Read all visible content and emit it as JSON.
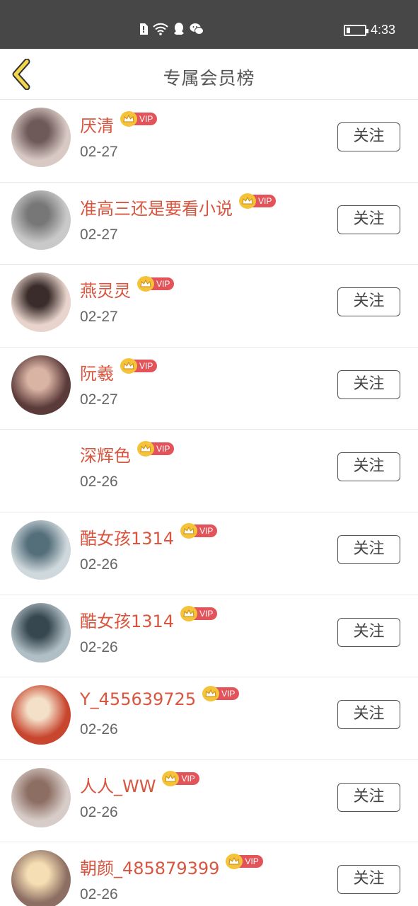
{
  "status_bar": {
    "time": "4:33",
    "battery_level": 0.2,
    "icons": [
      "sim-alert-icon",
      "wifi-icon",
      "qq-icon",
      "wechat-icon"
    ]
  },
  "header": {
    "back_icon": "chevron-left-icon",
    "title": "专属会员榜"
  },
  "colors": {
    "name": "#d9553f",
    "vip_badge": "#e2545a",
    "crown": "#f5c33a",
    "status_bar": "#474747",
    "back_icon_fill": "#f2d64b"
  },
  "members": [
    {
      "name": "厌清",
      "badge": "VIP",
      "date": "02-27",
      "follow_label": "关注",
      "avatar": "avatar-photo"
    },
    {
      "name": "准高三还是要看小说",
      "badge": "VIP",
      "date": "02-27",
      "follow_label": "关注",
      "avatar": "avatar-photo"
    },
    {
      "name": "燕灵灵",
      "badge": "VIP",
      "date": "02-27",
      "follow_label": "关注",
      "avatar": "avatar-photo"
    },
    {
      "name": "阮羲",
      "badge": "VIP",
      "date": "02-27",
      "follow_label": "关注",
      "avatar": "avatar-photo"
    },
    {
      "name": "深辉色",
      "badge": "VIP",
      "date": "02-26",
      "follow_label": "关注",
      "avatar": "none"
    },
    {
      "name": "酷女孩1314",
      "badge": "VIP",
      "date": "02-26",
      "follow_label": "关注",
      "avatar": "avatar-photo"
    },
    {
      "name": "酷女孩1314",
      "badge": "VIP",
      "date": "02-26",
      "follow_label": "关注",
      "avatar": "avatar-photo"
    },
    {
      "name": "Y_455639725",
      "badge": "VIP",
      "date": "02-26",
      "follow_label": "关注",
      "avatar": "avatar-photo"
    },
    {
      "name": "人人_WW",
      "badge": "VIP",
      "date": "02-26",
      "follow_label": "关注",
      "avatar": "avatar-photo"
    },
    {
      "name": "朝颜_485879399",
      "badge": "VIP",
      "date": "02-26",
      "follow_label": "关注",
      "avatar": "avatar-photo"
    }
  ]
}
